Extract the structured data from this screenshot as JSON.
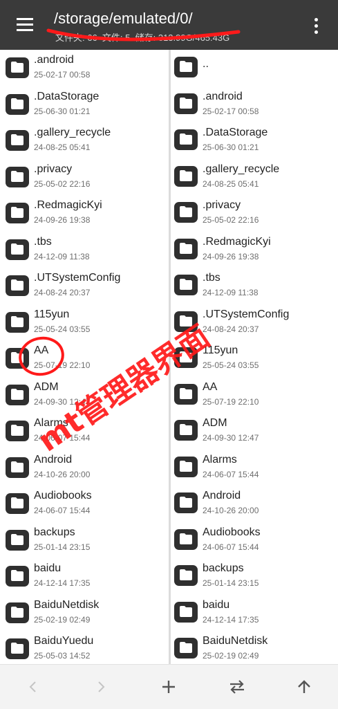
{
  "header": {
    "path": "/storage/emulated/0/",
    "folders_label": "文件夹: 66",
    "files_label": "文件: 5",
    "storage_label": "储存: 313.99G/465.43G"
  },
  "left_pane": {
    "items": [
      {
        "name": ".android",
        "date": "25-02-17 00:58"
      },
      {
        "name": ".DataStorage",
        "date": "25-06-30 01:21"
      },
      {
        "name": ".gallery_recycle",
        "date": "24-08-25 05:41"
      },
      {
        "name": ".privacy",
        "date": "25-05-02 22:16"
      },
      {
        "name": ".RedmagicKyi",
        "date": "24-09-26 19:38"
      },
      {
        "name": ".tbs",
        "date": "24-12-09 11:38"
      },
      {
        "name": ".UTSystemConfig",
        "date": "24-08-24 20:37"
      },
      {
        "name": "115yun",
        "date": "25-05-24 03:55"
      },
      {
        "name": "AA",
        "date": "25-07-19 22:10"
      },
      {
        "name": "ADM",
        "date": "24-09-30 12:47"
      },
      {
        "name": "Alarms",
        "date": "24-06-07 15:44"
      },
      {
        "name": "Android",
        "date": "24-10-26 20:00"
      },
      {
        "name": "Audiobooks",
        "date": "24-06-07 15:44"
      },
      {
        "name": "backups",
        "date": "25-01-14 23:15"
      },
      {
        "name": "baidu",
        "date": "24-12-14 17:35"
      },
      {
        "name": "BaiduNetdisk",
        "date": "25-02-19 02:49"
      },
      {
        "name": "BaiduYuedu",
        "date": "25-05-03 14:52"
      }
    ]
  },
  "right_pane": {
    "parent_label": "..",
    "items": [
      {
        "name": ".android",
        "date": "25-02-17 00:58"
      },
      {
        "name": ".DataStorage",
        "date": "25-06-30 01:21"
      },
      {
        "name": ".gallery_recycle",
        "date": "24-08-25 05:41"
      },
      {
        "name": ".privacy",
        "date": "25-05-02 22:16"
      },
      {
        "name": ".RedmagicKyi",
        "date": "24-09-26 19:38"
      },
      {
        "name": ".tbs",
        "date": "24-12-09 11:38"
      },
      {
        "name": ".UTSystemConfig",
        "date": "24-08-24 20:37"
      },
      {
        "name": "115yun",
        "date": "25-05-24 03:55"
      },
      {
        "name": "AA",
        "date": "25-07-19 22:10"
      },
      {
        "name": "ADM",
        "date": "24-09-30 12:47"
      },
      {
        "name": "Alarms",
        "date": "24-06-07 15:44"
      },
      {
        "name": "Android",
        "date": "24-10-26 20:00"
      },
      {
        "name": "Audiobooks",
        "date": "24-06-07 15:44"
      },
      {
        "name": "backups",
        "date": "25-01-14 23:15"
      },
      {
        "name": "baidu",
        "date": "24-12-14 17:35"
      },
      {
        "name": "BaiduNetdisk",
        "date": "25-02-19 02:49"
      }
    ]
  },
  "watermark": "mt管理器界面",
  "icons": {
    "menu": "hamburger-menu-icon",
    "more": "more-vertical-icon",
    "folder": "folder-icon",
    "back": "chevron-left-icon",
    "forward": "chevron-right-icon",
    "add": "plus-icon",
    "swap": "swap-arrows-icon",
    "up": "arrow-up-icon"
  },
  "colors": {
    "appbar": "#3a3a3a",
    "folder_tile": "#2f2f2f",
    "annotation": "#ff1a1a"
  }
}
